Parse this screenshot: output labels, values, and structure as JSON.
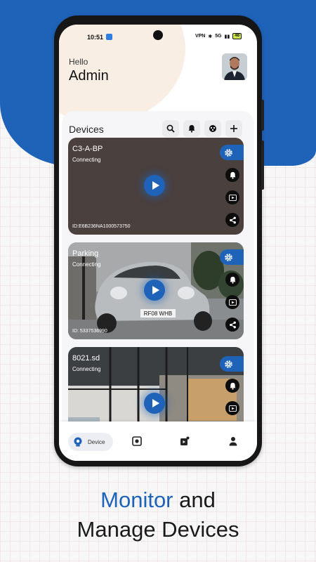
{
  "status_bar": {
    "time": "10:51",
    "vpn_label": "VPN",
    "signal_label": "5G",
    "battery_label": "48"
  },
  "header": {
    "greeting": "Hello",
    "username": "Admin"
  },
  "devices": {
    "title": "Devices",
    "actions": [
      "search-icon",
      "bell-icon",
      "cloud-icon",
      "plus-icon"
    ],
    "cards": [
      {
        "name": "C3-A-BP",
        "status": "Connecting",
        "id": "ID:E6B236NA1000573750"
      },
      {
        "name": "Parking",
        "status": "Connecting",
        "id": "ID: 5337536990"
      },
      {
        "name": "8021.sd",
        "status": "Connecting",
        "id": ""
      }
    ],
    "card_actions": [
      "gear-icon",
      "bell-icon",
      "playback-icon",
      "share-icon"
    ]
  },
  "nav": {
    "items": [
      {
        "label": "Device",
        "icon": "camera-icon",
        "active": true
      },
      {
        "label": "",
        "icon": "scan-icon"
      },
      {
        "label": "",
        "icon": "media-icon"
      },
      {
        "label": "",
        "icon": "person-icon"
      }
    ]
  },
  "caption": {
    "line1_accent": "Monitor",
    "line1_rest": " and",
    "line2": "Manage Devices"
  },
  "colors": {
    "accent": "#1f63b9",
    "peach": "#f9eee4",
    "card_dark": "#4a403e"
  }
}
